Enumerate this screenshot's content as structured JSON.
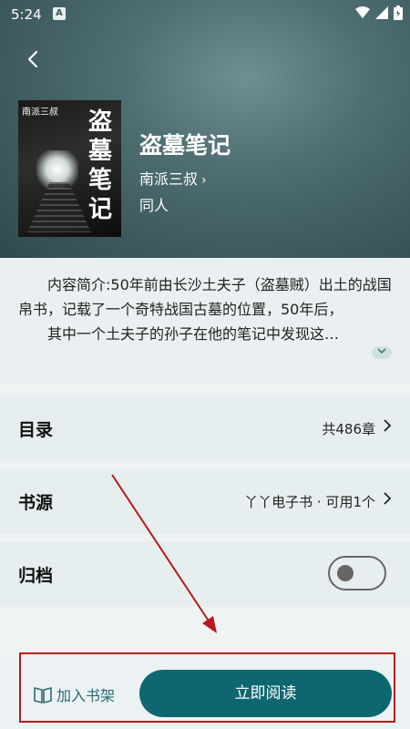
{
  "status": {
    "time": "5:24",
    "app_badge": "A"
  },
  "book": {
    "cover_author": "南派三叔",
    "cover_title": "盗墓笔记",
    "title": "盗墓笔记",
    "author": "南派三叔",
    "tag": "同人"
  },
  "intro": {
    "line1": "内容简介:50年前由长沙土夫子（盗墓贼）出土的战国帛书，记载了一个奇特战国古墓的位置，50年后，",
    "line2": "其中一个土夫子的孙子在他的笔记中发现这…"
  },
  "rows": {
    "toc": {
      "label": "目录",
      "value": "共486章"
    },
    "source": {
      "label": "书源",
      "value": "丫丫电子书 · 可用1个"
    },
    "archive": {
      "label": "归档",
      "toggle_on": false
    }
  },
  "bottom": {
    "bookshelf_label": "加入书架",
    "read_label": "立即阅读"
  },
  "colors": {
    "accent": "#0e6770",
    "annotation": "#c0151c"
  }
}
